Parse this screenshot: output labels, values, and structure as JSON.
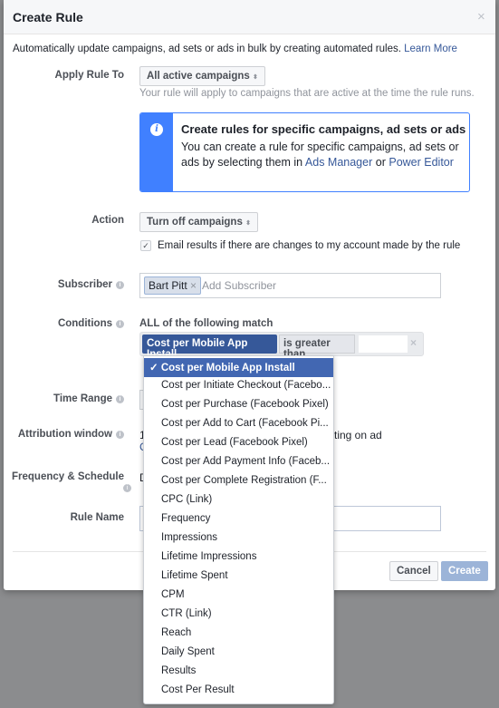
{
  "dialog": {
    "title": "Create Rule",
    "close_glyph": "×",
    "description": "Automatically update campaigns, ad sets or ads in bulk by creating automated rules.",
    "learn_more": "Learn More"
  },
  "apply_rule": {
    "label": "Apply Rule To",
    "value": "All active campaigns",
    "hint": "Your rule will apply to campaigns that are active at the time the rule runs."
  },
  "info_box": {
    "title": "Create rules for specific campaigns, ad sets or ads",
    "text": "You can create a rule for specific campaigns, ad sets or ads by selecting them in",
    "link1": "Ads Manager",
    "or": "or",
    "link2": "Power Editor"
  },
  "action": {
    "label": "Action",
    "value": "Turn off campaigns",
    "email_checkbox_label": "Email results if there are changes to my account made by the rule",
    "email_checked": true
  },
  "subscriber": {
    "label": "Subscriber",
    "token": "Bart Pitt",
    "placeholder": "Add Subscriber"
  },
  "conditions": {
    "label": "Conditions",
    "match_text": "ALL of the following match",
    "metric": "Cost per Mobile App Install",
    "operator": "is greater than",
    "value": ""
  },
  "dropdown": {
    "selected": "Cost per Mobile App Install",
    "options": [
      "Cost per Mobile App Install",
      "Cost per Initiate Checkout (Facebo...",
      "Cost per Purchase (Facebook Pixel)",
      "Cost per Add to Cart (Facebook Pi...",
      "Cost per Lead (Facebook Pixel)",
      "Cost per Add Payment Info (Faceb...",
      "Cost per Complete Registration (F...",
      "CPC (Link)",
      "Frequency",
      "Impressions",
      "Lifetime Impressions",
      "Lifetime Spent",
      "CPM",
      "CTR (Link)",
      "Reach",
      "Daily Spent",
      "Results",
      "Cost Per Result"
    ]
  },
  "time_range": {
    "label": "Time Range"
  },
  "attribution": {
    "label": "Attribution window",
    "value_start": "1",
    "value_end": "ting on ad",
    "link_start": "C"
  },
  "frequency": {
    "label": "Frequency & Schedule",
    "value_start": "D"
  },
  "rule_name": {
    "label": "Rule Name",
    "value": ""
  },
  "footer": {
    "cancel": "Cancel",
    "create": "Create"
  },
  "colors": {
    "brand": "#365899",
    "info": "#4080ff",
    "selected": "#4267b2",
    "disabled_button": "#9cb4d8"
  }
}
